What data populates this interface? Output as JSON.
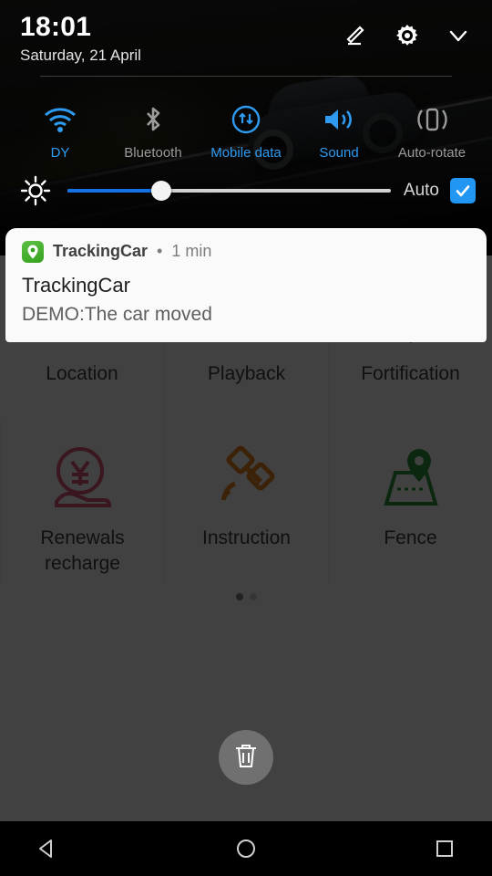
{
  "status": {
    "time": "18:01",
    "date": "Saturday, 21 April",
    "actions": [
      {
        "name": "edit-icon",
        "label": "Edit"
      },
      {
        "name": "settings-icon",
        "label": "Settings"
      },
      {
        "name": "chevron-down-icon",
        "label": "Collapse"
      }
    ]
  },
  "quick_settings": {
    "toggles": [
      {
        "label": "DY",
        "icon": "wifi-icon",
        "active": true
      },
      {
        "label": "Bluetooth",
        "icon": "bluetooth-icon",
        "active": false
      },
      {
        "label": "Mobile data",
        "icon": "mobile-data-icon",
        "active": true
      },
      {
        "label": "Sound",
        "icon": "sound-icon",
        "active": true
      },
      {
        "label": "Auto-rotate",
        "icon": "auto-rotate-icon",
        "active": false
      }
    ],
    "brightness": {
      "icon": "brightness-icon",
      "value_percent": 29,
      "auto_label": "Auto",
      "auto_checked": true
    }
  },
  "notification": {
    "app_icon": "trackingcar-app-icon",
    "app_name": "TrackingCar",
    "separator": "•",
    "time": "1 min",
    "title": "TrackingCar",
    "body": "DEMO:The car moved"
  },
  "clear_all": {
    "icon": "trash-icon",
    "label": "Clear all notifications"
  },
  "background_app": {
    "banner": {
      "name": "car-on-road-banner",
      "page_dots": 3,
      "active_dot": 1
    },
    "grid": [
      {
        "label": "Location",
        "icon": "car-pin-icon",
        "color": "#c2611f"
      },
      {
        "label": "Playback",
        "icon": "map-pin-icon",
        "color": "#c0392b"
      },
      {
        "label": "Fortification",
        "icon": "shield-icon",
        "color": "#2f6f9f"
      },
      {
        "label": "Renewals\nrecharge",
        "icon": "yen-hand-icon",
        "color": "#cf4f6e"
      },
      {
        "label": "Instruction",
        "icon": "satellite-icon",
        "color": "#d77a1e"
      },
      {
        "label": "Fence",
        "icon": "fence-map-icon",
        "color": "#2e8b3c"
      }
    ],
    "grid_page_dots": 2,
    "grid_active_dot": 0
  },
  "navbar": {
    "buttons": [
      {
        "label": "Back",
        "icon": "back-triangle-icon"
      },
      {
        "label": "Home",
        "icon": "home-circle-icon"
      },
      {
        "label": "Recents",
        "icon": "recents-square-icon"
      }
    ]
  },
  "colors": {
    "accent_blue": "#2196f3",
    "toggle_active": "#2f9bf0",
    "toggle_inactive": "#9b9b9b",
    "card_bg": "#fafafa"
  }
}
